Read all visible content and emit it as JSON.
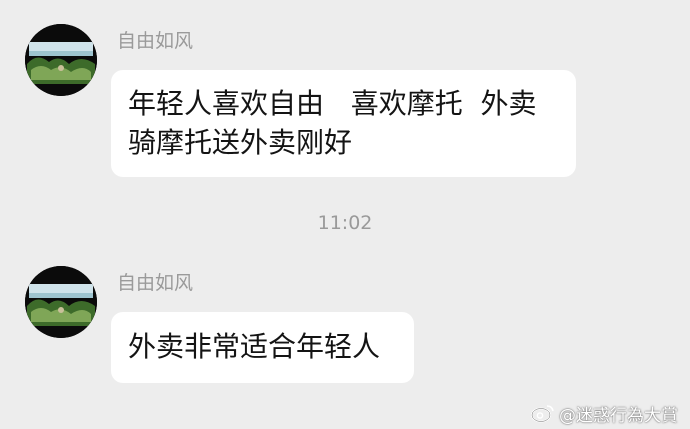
{
  "messages": [
    {
      "sender": "自由如风",
      "lines": [
        "年轻人喜欢自由   喜欢摩托  外卖",
        "骑摩托送外卖刚好"
      ]
    },
    {
      "sender": "自由如风",
      "lines": [
        "外卖非常适合年轻人"
      ]
    }
  ],
  "timestamp": "11:02",
  "avatar": {
    "icon": "landscape-avatar",
    "colors": [
      "#0b0b0b",
      "#cfe3ea",
      "#3d6b2a",
      "#7fa657"
    ]
  },
  "watermark": {
    "icon": "weibo-logo-icon",
    "text": "@迷惑行為大賞"
  },
  "colors": {
    "background": "#ededed",
    "bubble": "#ffffff",
    "meta_text": "#9a9a9a"
  }
}
